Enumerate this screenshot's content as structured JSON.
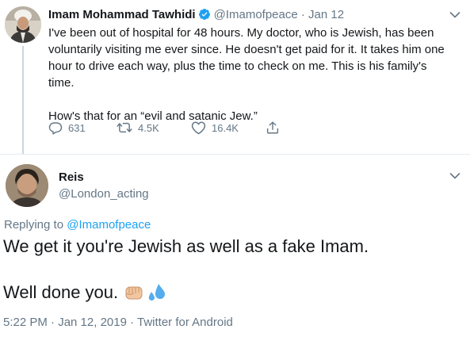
{
  "colors": {
    "text": "#14171a",
    "secondary": "#657786",
    "accent": "#1da1f2",
    "border": "#e6ecf0"
  },
  "tweet1": {
    "name": "Imam Mohammad Tawhidi",
    "handle": "@Imamofpeace",
    "separator": "·",
    "date": "Jan 12",
    "body_line1": "I've been out of hospital for 48 hours. My doctor, who is Jewish, has been",
    "body_line2": "voluntarily visiting me ever since. He doesn't get paid for it. It takes him one",
    "body_line3": "hour to drive each way, plus the time to check on me. This is his family's",
    "body_line4": "time.",
    "body_line5": "How's that for an “evil and satanic Jew.”",
    "counts": {
      "replies": "631",
      "retweets": "4.5K",
      "likes": "16.4K"
    },
    "icons": [
      "verified-badge-icon",
      "reply-icon",
      "retweet-icon",
      "like-icon",
      "share-icon",
      "chevron-down-icon"
    ]
  },
  "tweet2": {
    "name": "Reis",
    "handle": "@London_acting",
    "replying_prefix": "Replying to",
    "replying_mention": "@Imamofpeace",
    "text_line1": "We get it you're Jewish as well as a fake Imam.",
    "text_line2": "Well done you.",
    "emojis": [
      "oncoming-fist-icon",
      "sweat-droplets-icon"
    ],
    "meta": "5:22 PM · Jan 12, 2019 · Twitter for Android"
  }
}
